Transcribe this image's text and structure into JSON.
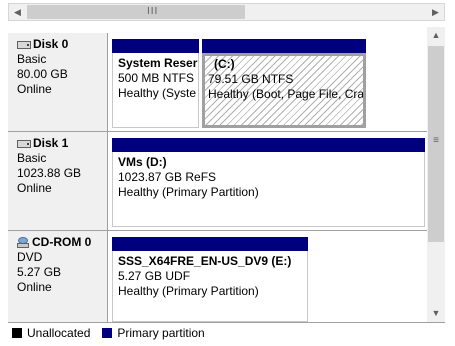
{
  "scrollbar": {
    "grip": "III"
  },
  "disks": [
    {
      "name": "Disk 0",
      "type": "Basic",
      "size": "80.00 GB",
      "status": "Online",
      "partitions": [
        {
          "name": "System Reser",
          "size_fs": "500 MB NTFS",
          "status": "Healthy (Syste"
        },
        {
          "name": "(C:)",
          "size_fs": "79.51 GB NTFS",
          "status": "Healthy (Boot, Page File, Cra"
        }
      ]
    },
    {
      "name": "Disk 1",
      "type": "Basic",
      "size": "1023.88 GB",
      "status": "Online",
      "partitions": [
        {
          "name": "VMs  (D:)",
          "size_fs": "1023.87 GB ReFS",
          "status": "Healthy (Primary Partition)"
        }
      ]
    },
    {
      "name": "CD-ROM 0",
      "type": "DVD",
      "size": "5.27 GB",
      "status": "Online",
      "partitions": [
        {
          "name": "SSS_X64FRE_EN-US_DV9  (E:)",
          "size_fs": "5.27 GB UDF",
          "status": "Healthy (Primary Partition)"
        }
      ]
    }
  ],
  "legend": [
    {
      "label": "Unallocated",
      "color": "#000000"
    },
    {
      "label": "Primary partition",
      "color": "#00007f"
    }
  ]
}
